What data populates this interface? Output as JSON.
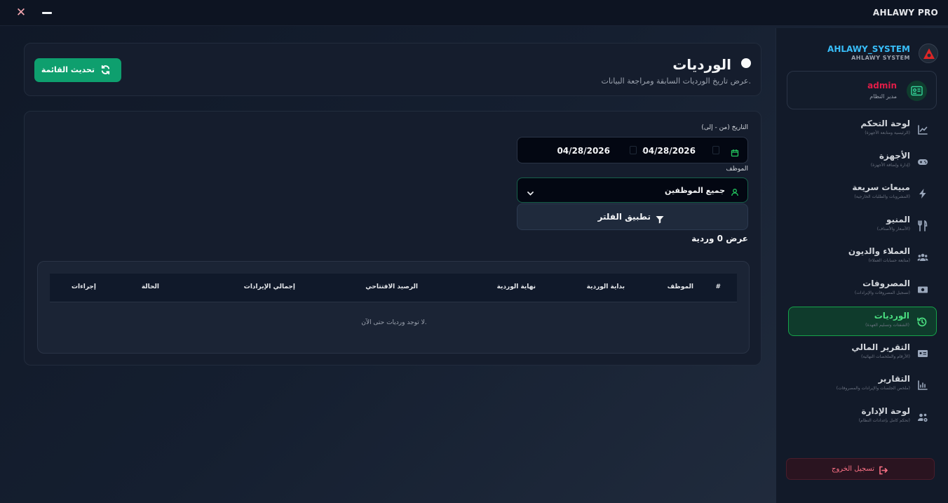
{
  "window": {
    "title": "AHLAWY PRO"
  },
  "brand": {
    "name": "AHLAWY_SYSTEM",
    "subtitle": "AHLAWY SYSTEM"
  },
  "user": {
    "name": "admin",
    "role": "مدير النظام"
  },
  "nav": {
    "items": [
      {
        "label": "لوحة التحكم",
        "sub": "(الرئيسية ومتابعة الأجهزة)",
        "icon": "chart-line-icon",
        "active": false
      },
      {
        "label": "الأجهزة",
        "sub": "(إدارة وإضافة الأجهزة)",
        "icon": "gamepad-icon",
        "active": false
      },
      {
        "label": "مبيعات سريعة",
        "sub": "(المشروبات والطلبات الخارجية)",
        "icon": "bolt-icon",
        "active": false
      },
      {
        "label": "المنيو",
        "sub": "(الأسعار والأصناف)",
        "icon": "utensils-icon",
        "active": false
      },
      {
        "label": "العملاء والديون",
        "sub": "(متابعة حسابات العملاء)",
        "icon": "users-icon",
        "active": false
      },
      {
        "label": "المصروفات",
        "sub": "(تسجيل المصروفات والإيرادات)",
        "icon": "money-icon",
        "active": false
      },
      {
        "label": "الورديات",
        "sub": "(الشفتات وتسليم العهدة)",
        "icon": "history-icon",
        "active": true
      },
      {
        "label": "التقرير المالي",
        "sub": "(الأرقام والملخصات النهائية)",
        "icon": "id-card-icon",
        "active": false
      },
      {
        "label": "التقارير",
        "sub": "(ملخص الجلسات والإيرادات والمصروفات)",
        "icon": "bar-chart-icon",
        "active": false
      },
      {
        "label": "لوحة الإدارة",
        "sub": "(تحكم كامل بإعدادات النظام)",
        "icon": "users-cog-icon",
        "active": false
      }
    ],
    "logout": "تسجيل الخروج"
  },
  "header": {
    "title": "الورديات",
    "subtitle": "عرض تاريخ الورديات السابقة ومراجعة البيانات.",
    "refresh_label": "تحديث القائمة"
  },
  "filters": {
    "date_label": "التاريخ (من - إلى)",
    "date_from": "04/28/2026",
    "date_separator": "-",
    "date_to": "04/28/2026",
    "employee_label": "الموظف",
    "employee_value": "جميع الموظفين",
    "apply_label": "تطبيق الفلتر"
  },
  "count_text": "عرض 0 وردية",
  "table": {
    "headers": [
      "#",
      "الموظف",
      "بداية الوردية",
      "نهاية الوردية",
      "الرصيد الافتتاحي",
      "إجمالي الإيرادات",
      "الحالة",
      "إجراءات"
    ],
    "empty_message": "لا توجد ورديات حتى الآن."
  },
  "colors": {
    "accent_green": "#0e9f6e",
    "active_nav": "#4ade80",
    "brand_blue": "#38bdf8",
    "admin_red": "#e11d48"
  }
}
